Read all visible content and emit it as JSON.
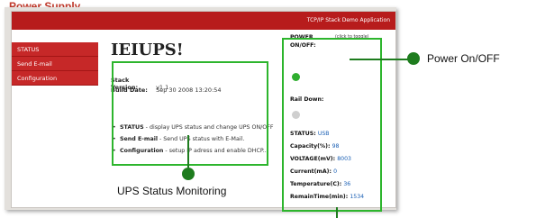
{
  "header": {
    "top_text": "Power Supply"
  },
  "app": {
    "banner": "TCP/IP Stack Demo Application"
  },
  "sidebar": {
    "items": [
      {
        "label": "STATUS"
      },
      {
        "label": "Send E-mail"
      },
      {
        "label": "Configuration"
      }
    ]
  },
  "main": {
    "title": "IEIUPS!",
    "stack_label": "Stack Version:",
    "stack_version": "v1.1",
    "build_label": "Build Date:",
    "build_date": "Sep 30 2008 13:20:54",
    "bullets": [
      {
        "term": "STATUS",
        "desc": " - display UPS status and change UPS ON/OFF"
      },
      {
        "term": "Send E-mail",
        "desc": " - Send UPS status with E-Mail."
      },
      {
        "term": "Configuration",
        "desc": " - setup IP adress and enable DHCP..."
      }
    ]
  },
  "panel": {
    "power_label": "POWER",
    "power_sub": "ON/OFF:",
    "toggle_hint": "(click to toggle)",
    "rail_label": "Rail Down:",
    "status_label": "STATUS:",
    "status_value": "USB",
    "rows": [
      {
        "label": "Capacity(%):",
        "value": "98"
      },
      {
        "label": "VOLTAGE(mV):",
        "value": "8003"
      },
      {
        "label": "Current(mA):",
        "value": "0"
      },
      {
        "label": "Temperature(C):",
        "value": "36"
      },
      {
        "label": "RemainTime(min):",
        "value": "1534"
      }
    ]
  },
  "annotations": {
    "power_callout": "Power On/OFF",
    "ups_callout": "UPS Status Monitoring"
  }
}
